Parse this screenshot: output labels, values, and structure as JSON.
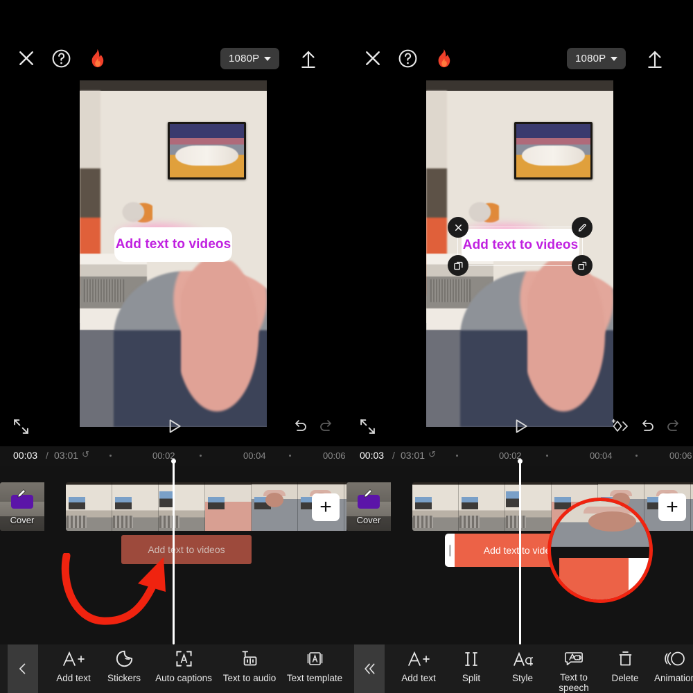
{
  "app": {
    "name": "CapCut Video Editor",
    "theme_bg": "#000000",
    "accent_selected_clip": "#ec6247",
    "accent_unselected_clip": "#9d4a3c",
    "text_overlay_color": "#c020e0",
    "annotation_color": "#f0230f"
  },
  "panels": [
    {
      "id": "left",
      "topbar": {
        "close_label": "close-icon",
        "help_label": "help-icon",
        "flame_label": "flame-icon",
        "resolution": "1080P",
        "export_label": "export-icon"
      },
      "preview": {
        "text_overlay": "Add text to videos",
        "selected": false
      },
      "playback": {
        "fullscreen_label": "fullscreen-icon",
        "play_label": "play-icon",
        "keyframe_visible": false,
        "undo_label": "undo-icon",
        "redo_label": "redo-icon"
      },
      "timeline": {
        "current_time": "00:03",
        "separator": "/",
        "total_time": "03:01",
        "loop_label": "↺",
        "ticks": [
          "00:02",
          "00:04",
          "00:06"
        ],
        "cover_label": "Cover",
        "add_clip_label": "+",
        "text_clip_label": "Add text to videos",
        "text_clip_selected": false
      },
      "toolbar": {
        "back_label": "‹",
        "items": [
          {
            "label": "Add text",
            "icon": "add-text-icon"
          },
          {
            "label": "Stickers",
            "icon": "stickers-icon"
          },
          {
            "label": "Auto captions",
            "icon": "auto-captions-icon"
          },
          {
            "label": "Text to audio",
            "icon": "text-to-audio-icon"
          },
          {
            "label": "Text template",
            "icon": "text-template-icon"
          }
        ]
      }
    },
    {
      "id": "right",
      "topbar": {
        "close_label": "close-icon",
        "help_label": "help-icon",
        "flame_label": "flame-icon",
        "resolution": "1080P",
        "export_label": "export-icon"
      },
      "preview": {
        "text_overlay": "Add text to videos",
        "selected": true,
        "handles": [
          {
            "name": "delete-handle",
            "glyph": "✕"
          },
          {
            "name": "edit-handle",
            "glyph": "✎"
          },
          {
            "name": "copy-handle",
            "glyph": "❐"
          },
          {
            "name": "resize-handle",
            "glyph": "⇱"
          }
        ]
      },
      "playback": {
        "fullscreen_label": "fullscreen-icon",
        "play_label": "play-icon",
        "keyframe_visible": true,
        "keyframe_label": "add-keyframe-icon",
        "undo_label": "undo-icon",
        "redo_label": "redo-icon"
      },
      "timeline": {
        "current_time": "00:03",
        "separator": "/",
        "total_time": "03:01",
        "loop_label": "↺",
        "ticks": [
          "00:02",
          "00:04",
          "00:06"
        ],
        "cover_label": "Cover",
        "add_clip_label": "+",
        "text_clip_label": "Add text to vide",
        "text_clip_selected": true
      },
      "toolbar": {
        "back_label": "«",
        "items": [
          {
            "label": "Add text",
            "icon": "add-text-icon"
          },
          {
            "label": "Split",
            "icon": "split-icon"
          },
          {
            "label": "Style",
            "icon": "style-icon"
          },
          {
            "label": "Text to speech",
            "icon": "text-to-speech-icon"
          },
          {
            "label": "Delete",
            "icon": "delete-icon"
          },
          {
            "label": "Animation",
            "icon": "animation-icon"
          }
        ]
      }
    }
  ],
  "annotations": {
    "arrow_label": "red-curved-arrow",
    "magnifier_label": "red-circle-magnifier"
  }
}
